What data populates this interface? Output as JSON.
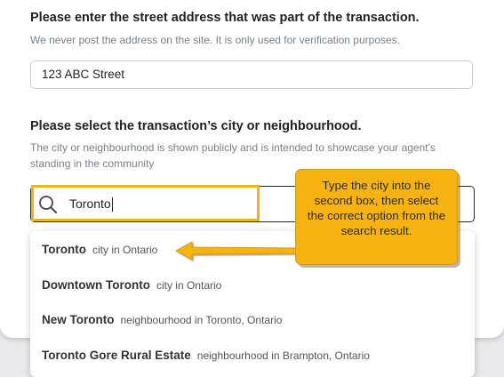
{
  "form": {
    "address_heading": "Please enter the street address that was part of the transaction.",
    "address_help": "We never post the address on the site. It is only used for verification purposes.",
    "address_value": "123 ABC Street",
    "city_heading": "Please select the transaction’s city or neighbourhood.",
    "city_help": "The city or neighbourhood is shown publicly and is intended to showcase your agent's standing in the community",
    "search_value": "Toronto"
  },
  "dropdown": {
    "options": [
      {
        "name": "Toronto",
        "desc": "city in Ontario"
      },
      {
        "name": "Downtown Toronto",
        "desc": "city in Ontario"
      },
      {
        "name": "New Toronto",
        "desc": "neighbourhood in Toronto, Ontario"
      },
      {
        "name": "Toronto Gore Rural Estate",
        "desc": "neighbourhood in Brampton, Ontario"
      }
    ]
  },
  "annotation": {
    "callout_text": "Type the city into the second box, then select the correct option from the search result.",
    "callout_color": "#f6b310",
    "highlight_color": "#f3b21b"
  },
  "icons": {
    "search": "search-icon"
  }
}
